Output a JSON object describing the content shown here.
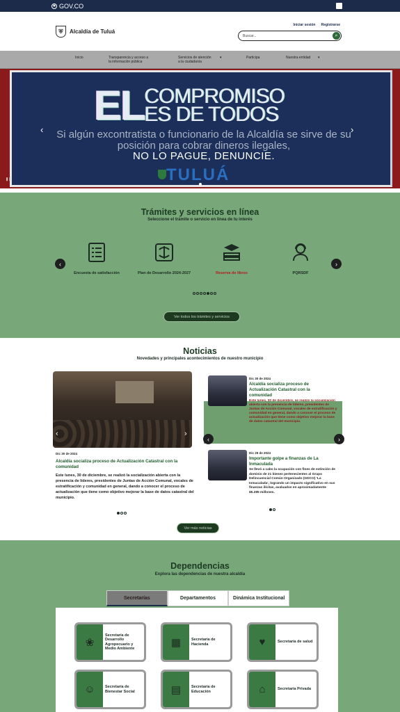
{
  "gov": {
    "label": "GOV.CO"
  },
  "header": {
    "brand": "Alcaldía de Tuluá",
    "login": "Iniciar sesión",
    "register": "Registrarse",
    "search_placeholder": "Buscar..."
  },
  "nav": {
    "items": [
      {
        "label": "Inicio"
      },
      {
        "label": "Transparencia y acceso a\nla información pública"
      },
      {
        "label": "Servicios de atención\na la ciudadanía"
      },
      {
        "label": "Participa"
      },
      {
        "label": "Nuestra entidad"
      }
    ]
  },
  "banner": {
    "big": "EL",
    "line1": "COMPROMISO",
    "line2": "ES DE TODOS",
    "body": "Si algún excontratista o funcionario de la Alcaldía se sirve de su posición para cobrar dineros ilegales,",
    "strong": "NO LO PAGUE, DENUNCIE.",
    "brand": "TULUÁ",
    "pause": "❚❚"
  },
  "tramites": {
    "title": "Trámites y servicios en línea",
    "subtitle": "Seleccione el trámite o servicio en línea de tu interés",
    "cards": [
      {
        "label": "Encuesta de satisfacción",
        "icon": "survey-icon"
      },
      {
        "label": "Plan de Desarrollo 2024-2027",
        "icon": "plan-icon"
      },
      {
        "label": "Reserva de libros",
        "icon": "books-icon"
      },
      {
        "label": "PQRSDF",
        "icon": "support-icon"
      }
    ],
    "button": "Ver todos los trámites y servicios"
  },
  "noticias": {
    "title": "Noticias",
    "subtitle": "Novedades y principales acontecimientos de nuestro municipio",
    "main": {
      "date": "Dic 30 de 2024",
      "title": "Alcaldía socializa proceso de Actualización Catastral con la comunidad",
      "body": "Este lunes, 30 de diciembre, se realizó la socialización abierta con la presencia de líderes, presidentes de Juntas de Acción Comunal, vocales de estratificación y comunidad en general, dando a conocer el proceso de actualización que tiene como objetivo mejorar la base de datos catastral del municipio."
    },
    "side": [
      {
        "date": "Dic 30 de 2024",
        "title": "Alcaldía socializa proceso de Actualización Catastral con la comunidad",
        "body": "Este lunes, 30 de diciembre, se realizó la socialización abierta con la presencia de líderes, presidentes de Juntas de Acción Comunal, vocales de estratificación y comunidad en general, dando a conocer el proceso de actualización que tiene como objetivo mejorar la base de datos catastral del municipio."
      },
      {
        "date": "Dic 29 de 2024",
        "title": "Importante golpe a finanzas de La Inmaculada",
        "body": "Se llevó a cabo la ocupación con fines de extinción de dominio de 21 bienes pertenecientes al Grupo Delincuencial Común Organizado (GDCO) 'La Inmaculada', logrando un impacto significativo en sus finanzas ilícitas, avaluados en aproximadamente $5.285 millones."
      }
    ],
    "button": "Ver más noticias"
  },
  "dependencias": {
    "title": "Dependencias",
    "subtitle": "Explora las dependencias de nuestra alcaldía",
    "tabs": [
      {
        "label": "Secretarías"
      },
      {
        "label": "Departamentos"
      },
      {
        "label": "Dinámica Institucional"
      }
    ],
    "cards": [
      {
        "label": "Secretaría de Desarrollo Agropecuario y Medio Ambiente",
        "icon": "plant-icon"
      },
      {
        "label": "Secretaría de Hacienda",
        "icon": "calculator-icon"
      },
      {
        "label": "Secretaría de salud",
        "icon": "health-icon"
      },
      {
        "label": "Secretaría de Bienestar Social",
        "icon": "community-icon"
      },
      {
        "label": "Secretaría de Educación",
        "icon": "education-icon"
      },
      {
        "label": "Secretaría Privada",
        "icon": "building-icon"
      }
    ]
  }
}
